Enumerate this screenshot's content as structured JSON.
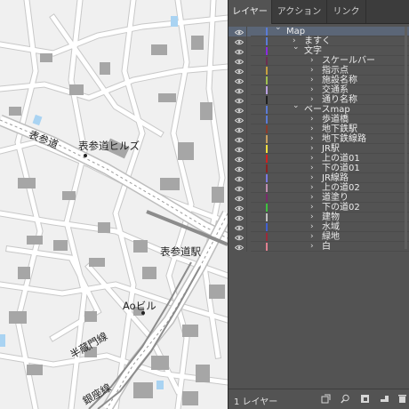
{
  "map": {
    "labels": {
      "omotesando": "表参道",
      "omotesando_hills": "表参道ヒルズ",
      "omotesando_station": "表参道駅",
      "ao_building": "Aoビル",
      "hanzomon_line": "半蔵門線",
      "ginza_line": "銀座線"
    },
    "colors": {
      "background": "#efefef",
      "road": "#ffffff",
      "building": "#9b9b9b",
      "railway": "#8a8a8a",
      "water": "#a9d3f2"
    }
  },
  "panel": {
    "tabs": [
      {
        "label": "レイヤー",
        "active": true
      },
      {
        "label": "アクション",
        "active": false
      },
      {
        "label": "リンク",
        "active": false
      }
    ],
    "layers": [
      {
        "name": "Map",
        "depth": 0,
        "expanded": true,
        "color": "#5b7bd5",
        "selected": true
      },
      {
        "name": "ますく",
        "depth": 1,
        "expanded": false,
        "color": "#5b7bd5"
      },
      {
        "name": "文字",
        "depth": 1,
        "expanded": true,
        "color": "#8a2be2"
      },
      {
        "name": "スケールバー",
        "depth": 2,
        "expanded": false,
        "color": "#6b2e4f"
      },
      {
        "name": "指示点",
        "depth": 2,
        "expanded": false,
        "color": "#c8a040"
      },
      {
        "name": "施設名称",
        "depth": 2,
        "expanded": false,
        "color": "#a0c050"
      },
      {
        "name": "交通系",
        "depth": 2,
        "expanded": false,
        "color": "#b8a0e0"
      },
      {
        "name": "通り名称",
        "depth": 2,
        "expanded": false,
        "color": "#202020"
      },
      {
        "name": "ベースmap",
        "depth": 1,
        "expanded": true,
        "color": "#5b7bd5"
      },
      {
        "name": "歩道橋",
        "depth": 2,
        "expanded": false,
        "color": "#5b7bd5"
      },
      {
        "name": "地下鉄駅",
        "depth": 2,
        "expanded": false,
        "color": "#8a3a2a"
      },
      {
        "name": "地下鉄線路",
        "depth": 2,
        "expanded": false,
        "color": "#c8a060"
      },
      {
        "name": "JR駅",
        "depth": 2,
        "expanded": false,
        "color": "#f0e040"
      },
      {
        "name": "上の道01",
        "depth": 2,
        "expanded": false,
        "color": "#d02020"
      },
      {
        "name": "下の道01",
        "depth": 2,
        "expanded": false,
        "color": "#8a2222"
      },
      {
        "name": "JR線路",
        "depth": 2,
        "expanded": false,
        "color": "#7a7ae0"
      },
      {
        "name": "上の道02",
        "depth": 2,
        "expanded": false,
        "color": "#c08fb0"
      },
      {
        "name": "道塗り",
        "depth": 2,
        "expanded": false,
        "color": "#7a2a6a"
      },
      {
        "name": "下の道02",
        "depth": 2,
        "expanded": false,
        "color": "#40c040"
      },
      {
        "name": "建物",
        "depth": 2,
        "expanded": false,
        "color": "#c0c0c0"
      },
      {
        "name": "水域",
        "depth": 2,
        "expanded": false,
        "color": "#4060d0"
      },
      {
        "name": "緑地",
        "depth": 2,
        "expanded": false,
        "color": "#9a2a3a"
      },
      {
        "name": "白",
        "depth": 2,
        "expanded": false,
        "color": "#e08090"
      }
    ],
    "footer": {
      "count_label": "1 レイヤー",
      "buttons": [
        "make-clipping-mask-icon",
        "locate-object-icon",
        "make-sublayer-icon",
        "new-layer-icon",
        "delete-layer-icon"
      ]
    }
  }
}
